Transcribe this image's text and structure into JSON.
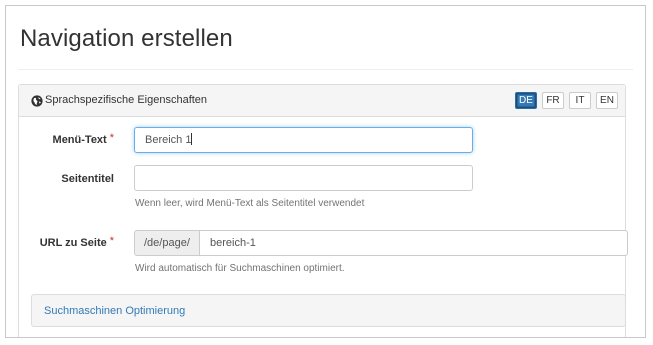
{
  "page_title": "Navigation erstellen",
  "panel": {
    "icon": "globe-icon",
    "title": "Sprachspezifische Eigenschaften",
    "languages": [
      {
        "code": "DE",
        "active": true
      },
      {
        "code": "FR",
        "active": false
      },
      {
        "code": "IT",
        "active": false
      },
      {
        "code": "EN",
        "active": false
      }
    ]
  },
  "form": {
    "menu_text": {
      "label": "Menü-Text",
      "required_mark": "*",
      "value": "Bereich 1"
    },
    "page_title_field": {
      "label": "Seitentitel",
      "value": "",
      "help": "Wenn leer, wird Menü-Text als Seitentitel verwendet"
    },
    "url": {
      "label": "URL zu Seite",
      "required_mark": "*",
      "prefix": "/de/page/",
      "value": "bereich-1",
      "help": "Wird automatisch für Suchmaschinen optimiert."
    }
  },
  "seo": {
    "link_label": "Suchmaschinen Optimierung"
  },
  "colors": {
    "accent": "#337ab7",
    "required": "#c9302c",
    "focus": "#66afe9"
  }
}
